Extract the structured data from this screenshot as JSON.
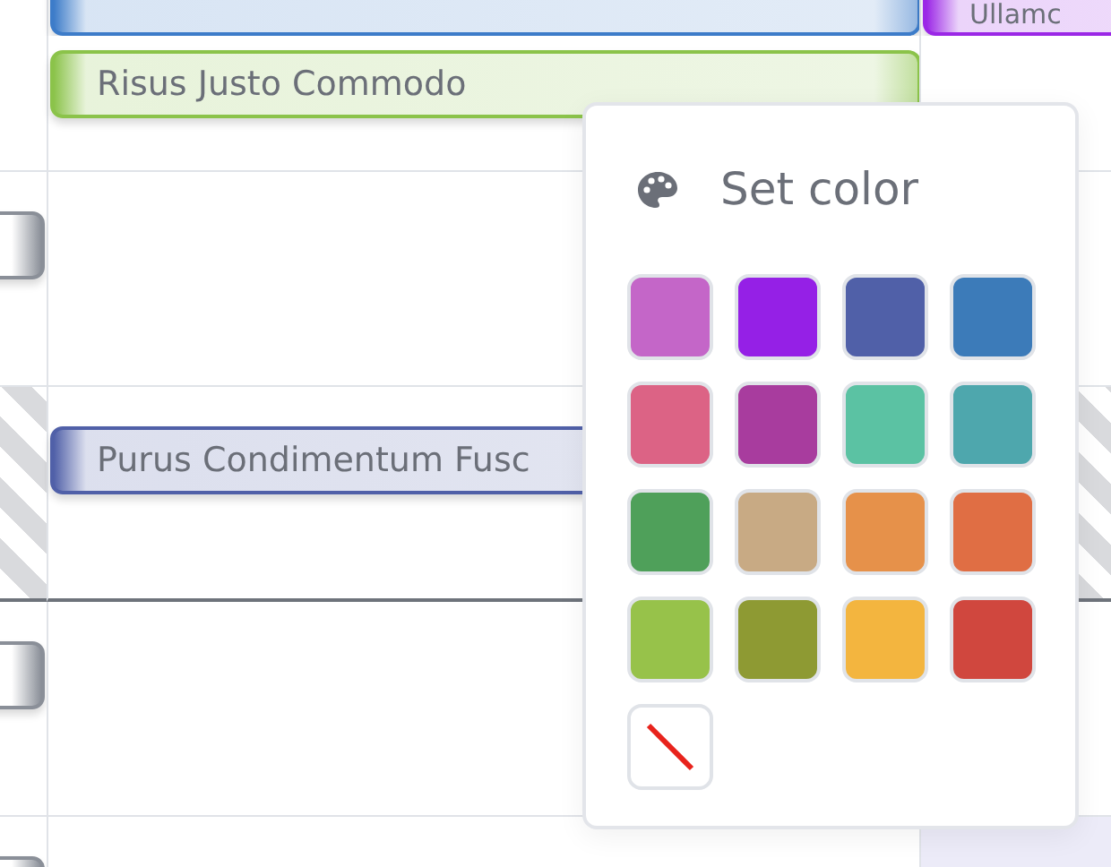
{
  "timeline": {
    "rows": [
      {
        "kind": "top",
        "cells": [
          {
            "events": [
              {
                "kind": "bar",
                "color": "#3d7cc9"
              }
            ]
          },
          {
            "events": [
              {
                "kind": "bar",
                "title": "Ullamc",
                "color": "#9b27e6"
              }
            ]
          }
        ]
      },
      {
        "kind": "normal",
        "cells": [
          {
            "events": [
              {
                "kind": "bar",
                "title": "Risus Justo Commodo",
                "color": "#8bc34a"
              }
            ]
          },
          {}
        ]
      },
      {
        "kind": "normal",
        "lead_stub": {
          "color": "#8a8f98"
        },
        "cells": [
          {},
          {}
        ]
      },
      {
        "kind": "hatched",
        "cells": [
          {
            "events": [
              {
                "kind": "bar",
                "title": "Purus Condimentum Fusc",
                "color": "#5060a8"
              }
            ]
          },
          {}
        ]
      },
      {
        "kind": "normal",
        "lead_stub": {
          "color": "#8a8f98"
        },
        "cells": [
          {},
          {}
        ]
      },
      {
        "kind": "bottom",
        "lead_stub": {
          "color": "#8a8f98"
        },
        "cells": [
          {},
          {}
        ]
      }
    ]
  },
  "color_menu": {
    "title": "Set color",
    "swatches": [
      {
        "kind": "color",
        "color": "#c466c8"
      },
      {
        "kind": "color",
        "color": "#9520e6"
      },
      {
        "kind": "color",
        "color": "#5060a8"
      },
      {
        "kind": "color",
        "color": "#3c7bb9"
      },
      {
        "kind": "color",
        "color": "#dc6385"
      },
      {
        "kind": "color",
        "color": "#a83c9e"
      },
      {
        "kind": "color",
        "color": "#5bc2a3"
      },
      {
        "kind": "color",
        "color": "#4ea7ad"
      },
      {
        "kind": "color",
        "color": "#4fa05a"
      },
      {
        "kind": "color",
        "color": "#c8aa84"
      },
      {
        "kind": "color",
        "color": "#e6914a"
      },
      {
        "kind": "color",
        "color": "#e06e44"
      },
      {
        "kind": "color",
        "color": "#97c24a"
      },
      {
        "kind": "color",
        "color": "#8e9a33"
      },
      {
        "kind": "color",
        "color": "#f3b53f"
      },
      {
        "kind": "color",
        "color": "#d0473e"
      },
      {
        "kind": "none"
      }
    ]
  }
}
